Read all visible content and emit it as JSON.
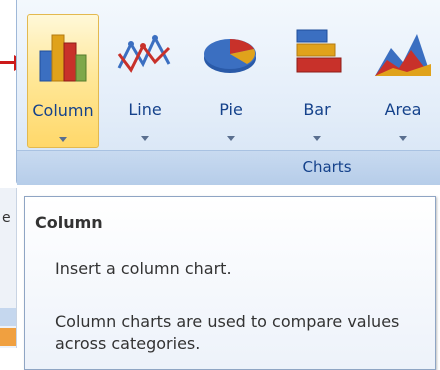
{
  "ribbon": {
    "group_label": "Charts",
    "buttons": [
      {
        "label": "Column",
        "icon": "column-chart-icon"
      },
      {
        "label": "Line",
        "icon": "line-chart-icon"
      },
      {
        "label": "Pie",
        "icon": "pie-chart-icon"
      },
      {
        "label": "Bar",
        "icon": "bar-chart-icon"
      },
      {
        "label": "Area",
        "icon": "area-chart-icon"
      }
    ]
  },
  "tooltip": {
    "title": "Column",
    "description": "Insert a column chart.",
    "details": "Column charts are used to compare values across categories."
  },
  "edge": {
    "fragment": "e"
  },
  "colors": {
    "ribbon_label": "#15428b",
    "active_button": "#ffd86a",
    "arrow": "#cc1a1a"
  }
}
